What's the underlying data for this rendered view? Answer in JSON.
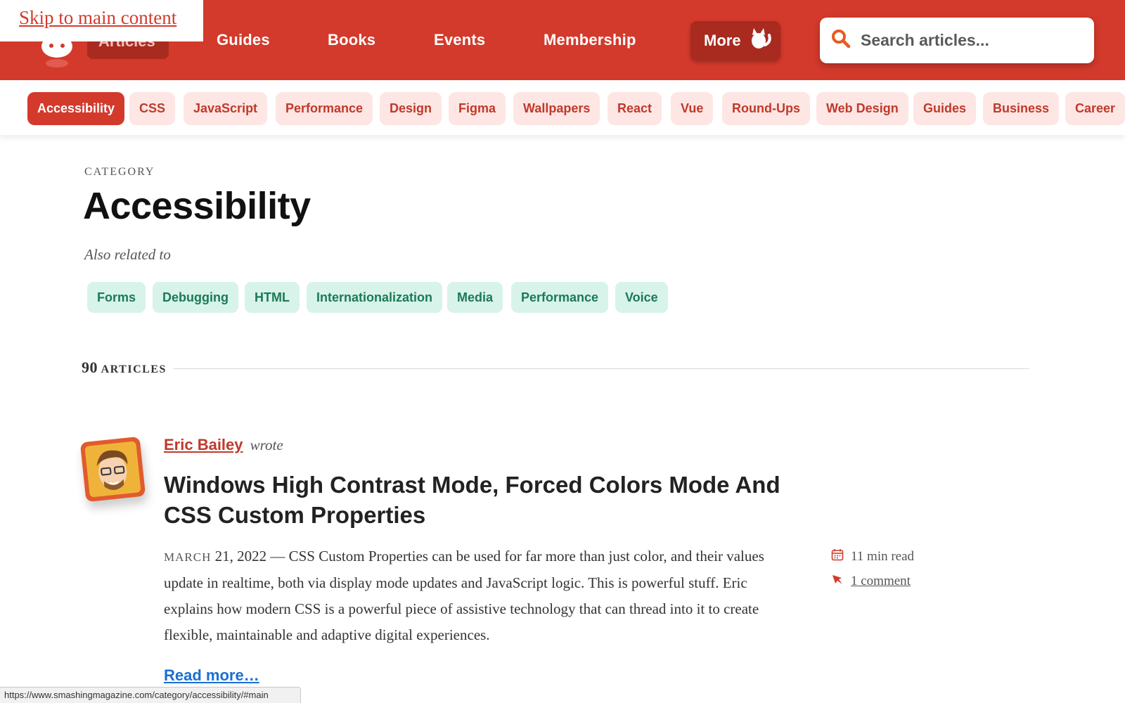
{
  "skip_link": "Skip to main content",
  "header": {
    "nav": {
      "articles": "Articles",
      "guides": "Guides",
      "books": "Books",
      "events": "Events",
      "membership": "Membership",
      "more": "More"
    },
    "search_placeholder": "Search articles..."
  },
  "categories": [
    "Accessibility",
    "CSS",
    "JavaScript",
    "Performance",
    "Design",
    "Figma",
    "Wallpapers",
    "React",
    "Vue",
    "Round-Ups",
    "Web Design",
    "Guides",
    "Business",
    "Career"
  ],
  "main": {
    "category_label": "CATEGORY",
    "title": "Accessibility",
    "related_label": "Also related to",
    "related_tags": [
      "Forms",
      "Debugging",
      "HTML",
      "Internationalization",
      "Media",
      "Performance",
      "Voice"
    ],
    "article_count": "90",
    "articles_label": "ARTICLES"
  },
  "article": {
    "author": "Eric Bailey",
    "wrote": "wrote",
    "title": "Windows High Contrast Mode, Forced Colors Mode And CSS Custom Properties",
    "date_month": "MARCH",
    "date_rest": "21, 2022",
    "excerpt": "CSS Custom Properties can be used for far more than just color, and their values update in realtime, both via display mode updates and JavaScript logic. This is powerful stuff. Eric explains how modern CSS is a powerful piece of assistive technology that can thread into it to create flexible, maintainable and adaptive digital experiences.",
    "read_time": "11 min read",
    "comments": "1 comment",
    "read_more": "Read more…"
  },
  "status_url": "https://www.smashingmagazine.com/category/accessibility/#main",
  "colors": {
    "brand_red": "#d33a2c",
    "dark_red": "#a92a1f",
    "pill_bg": "#fde6e3",
    "tag_bg": "#d8f3ea",
    "tag_text": "#1b7a56",
    "link_blue": "#1a6fd1"
  },
  "icons": {
    "logo": "cat-logo-icon",
    "more": "cat-icon",
    "search": "search-icon",
    "read_time": "calendar-icon",
    "comments": "comment-icon"
  }
}
